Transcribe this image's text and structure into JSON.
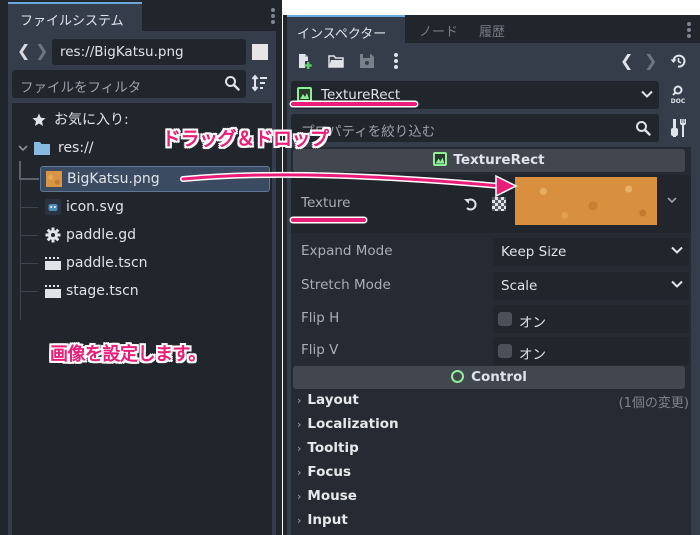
{
  "filesystem": {
    "tab_label": "ファイルシステム",
    "nav_back": "❮",
    "nav_forward": "❯",
    "path": "res://BigKatsu.png",
    "filter_placeholder": "ファイルをフィルタ",
    "favorites_label": "お気に入り:",
    "root_label": "res://",
    "files": [
      {
        "name": "BigKatsu.png",
        "icon": "image-file-icon",
        "selected": true
      },
      {
        "name": "icon.svg",
        "icon": "godot-icon",
        "selected": false
      },
      {
        "name": "paddle.gd",
        "icon": "gear-script-icon",
        "selected": false
      },
      {
        "name": "paddle.tscn",
        "icon": "scene-clapper-icon",
        "selected": false
      },
      {
        "name": "stage.tscn",
        "icon": "scene-clapper-icon",
        "selected": false
      }
    ]
  },
  "inspector": {
    "tabs": [
      {
        "label": "インスペクター",
        "active": true
      },
      {
        "label": "ノード",
        "active": false
      },
      {
        "label": "履歴",
        "active": false
      }
    ],
    "nav_back": "❮",
    "nav_forward": "❯",
    "object_name": "TextureRect",
    "property_filter_placeholder": "プロパティを絞り込む",
    "section_texturerect": "TextureRect",
    "texture_label": "Texture",
    "properties": [
      {
        "label": "Expand Mode",
        "value": "Keep Size",
        "type": "dropdown"
      },
      {
        "label": "Stretch Mode",
        "value": "Scale",
        "type": "dropdown"
      },
      {
        "label": "Flip H",
        "value": "オン",
        "type": "checkbox",
        "checked": false
      },
      {
        "label": "Flip V",
        "value": "オン",
        "type": "checkbox",
        "checked": false
      }
    ],
    "section_control": "Control",
    "groups": [
      {
        "label": "Layout",
        "note": "(1個の変更)"
      },
      {
        "label": "Localization",
        "note": ""
      },
      {
        "label": "Tooltip",
        "note": ""
      },
      {
        "label": "Focus",
        "note": ""
      },
      {
        "label": "Mouse",
        "note": ""
      },
      {
        "label": "Input",
        "note": ""
      }
    ],
    "colors": {
      "node_green": "#8eef97",
      "accent_blue": "#6da6db"
    }
  },
  "annotations": {
    "drag_drop": "ドラッグ＆ドロップ",
    "set_image": "画像を設定します。",
    "color": "#ea1e7a"
  }
}
